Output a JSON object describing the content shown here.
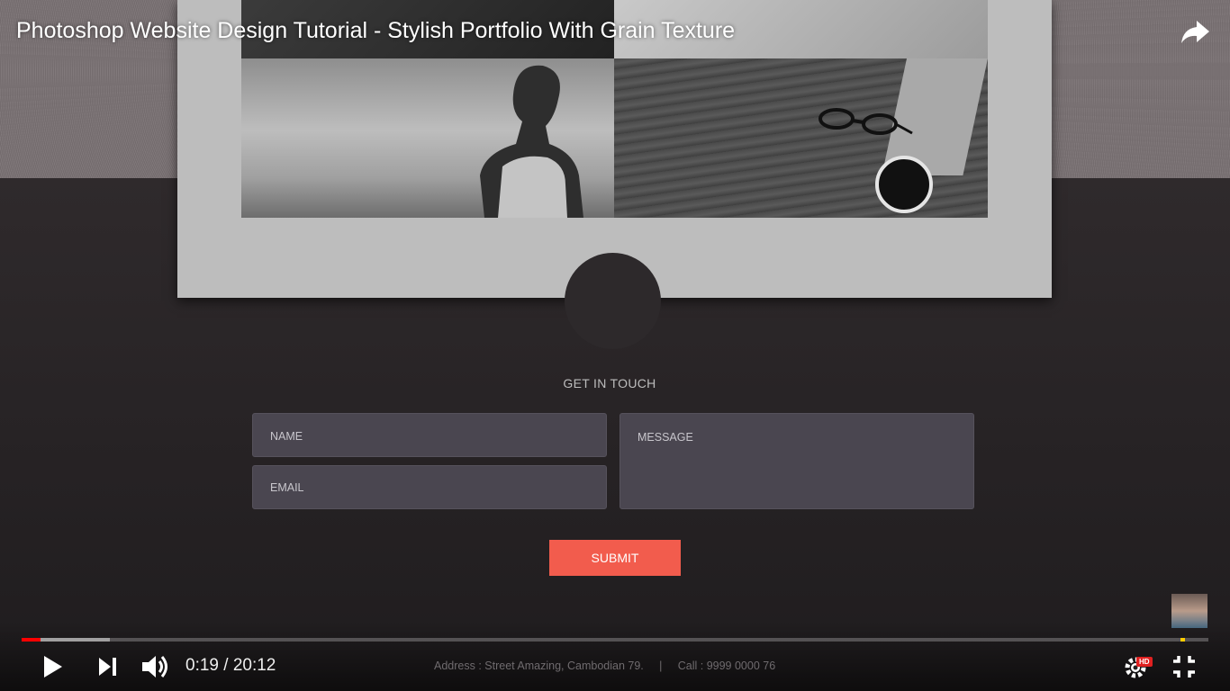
{
  "video": {
    "title": "Photoshop Website Design Tutorial - Stylish Portfolio With Grain Texture",
    "current_time": "0:19",
    "duration": "20:12",
    "time_display": "0:19 / 20:12",
    "played_fraction": 0.016,
    "buffered_fraction": 0.074
  },
  "page": {
    "contact_heading": "GET IN TOUCH",
    "name_placeholder": "NAME",
    "email_placeholder": "EMAIL",
    "message_placeholder": "MESSAGE",
    "submit_label": "SUBMIT",
    "footer": "Address : Street Amazing, Cambodian 79.     |     Call : 9999 0000 76"
  },
  "player": {
    "hd_badge": "HD",
    "icons": [
      "share-icon",
      "play-icon",
      "next-icon",
      "volume-icon",
      "settings-icon",
      "exit-fullscreen-icon"
    ]
  },
  "colors": {
    "accent": "#f25c4d",
    "progress_played": "#ff0000",
    "progress_marker": "#ffcc00",
    "field_bg": "#4a4650"
  }
}
